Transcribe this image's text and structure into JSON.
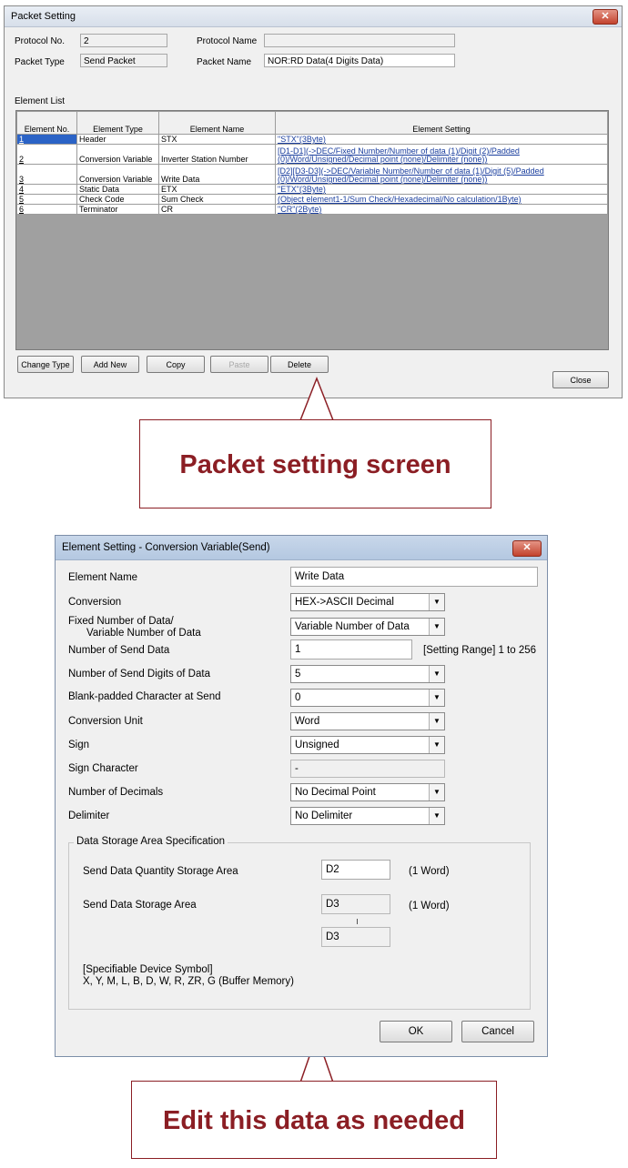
{
  "packet_window": {
    "title": "Packet Setting",
    "protocol_no_label": "Protocol No.",
    "protocol_no": "2",
    "protocol_name_label": "Protocol Name",
    "protocol_name": "",
    "packet_type_label": "Packet Type",
    "packet_type": "Send Packet",
    "packet_name_label": "Packet Name",
    "packet_name": "NOR:RD Data(4 Digits Data)",
    "element_list_label": "Element List",
    "columns": [
      "Element No.",
      "Element Type",
      "Element Name",
      "Element Setting"
    ],
    "rows": [
      {
        "no": "1",
        "type": "Header",
        "name": "STX",
        "setting": "\"STX\"(3Byte)"
      },
      {
        "no": "2",
        "type": "Conversion Variable",
        "name": "Inverter Station Number",
        "setting": "[D1-D1](->DEC/Fixed Number/Number of data (1)/Digit (2)/Padded (0)/Word/Unsigned/Decimal point (none)/Delimiter (none))"
      },
      {
        "no": "3",
        "type": "Conversion Variable",
        "name": "Write Data",
        "setting": "[D2][D3-D3](->DEC/Variable Number/Number of data (1)/Digit (5)/Padded (0)/Word/Unsigned/Decimal point (none)/Delimiter (none))"
      },
      {
        "no": "4",
        "type": "Static Data",
        "name": "ETX",
        "setting": "\"ETX\"(3Byte)"
      },
      {
        "no": "5",
        "type": "Check Code",
        "name": "Sum Check",
        "setting": "(Object element1-1/Sum Check/Hexadecimal/No calculation/1Byte)"
      },
      {
        "no": "6",
        "type": "Terminator",
        "name": "CR",
        "setting": "\"CR\"(2Byte)"
      }
    ],
    "buttons": {
      "change_type": "Change Type",
      "add_new": "Add New",
      "copy": "Copy",
      "paste": "Paste",
      "delete": "Delete",
      "close": "Close"
    }
  },
  "callout_top": "Packet setting screen",
  "element_window": {
    "title": "Element Setting - Conversion Variable(Send)",
    "element_name_label": "Element Name",
    "element_name": "Write Data",
    "conversion_label": "Conversion",
    "conversion": "HEX->ASCII Decimal",
    "fixed_variable_label_1": "Fixed Number of Data/",
    "fixed_variable_label_2": "Variable Number of Data",
    "fixed_variable": "Variable Number of Data",
    "send_data_count_label": "Number of Send Data",
    "send_data_count": "1",
    "setting_range": "[Setting Range] 1 to 256",
    "send_digits_label": "Number of Send Digits of  Data",
    "send_digits": "5",
    "blank_padded_label": "Blank-padded Character at Send",
    "blank_padded": "0",
    "conversion_unit_label": "Conversion Unit",
    "conversion_unit": "Word",
    "sign_label": "Sign",
    "sign": "Unsigned",
    "sign_character_label": "Sign Character",
    "sign_character": "-",
    "decimals_label": "Number of Decimals",
    "decimals": "No Decimal Point",
    "delimiter_label": "Delimiter",
    "delimiter": "No Delimiter",
    "group_title": "Data Storage Area Specification",
    "qty_area_label": "Send Data Quantity Storage Area",
    "qty_area": "D2",
    "qty_unit": "(1 Word)",
    "data_area_label": "Send Data Storage Area",
    "data_area_from": "D3",
    "data_area_to": "D3",
    "data_unit": "(1 Word)",
    "device_header": "[Specifiable Device Symbol]",
    "device_list": "X, Y, M, L, B, D, W, R, ZR, G (Buffer Memory)",
    "ok": "OK",
    "cancel": "Cancel"
  },
  "callout_bottom": "Edit this data as needed",
  "accent_color": "#8b1e24"
}
